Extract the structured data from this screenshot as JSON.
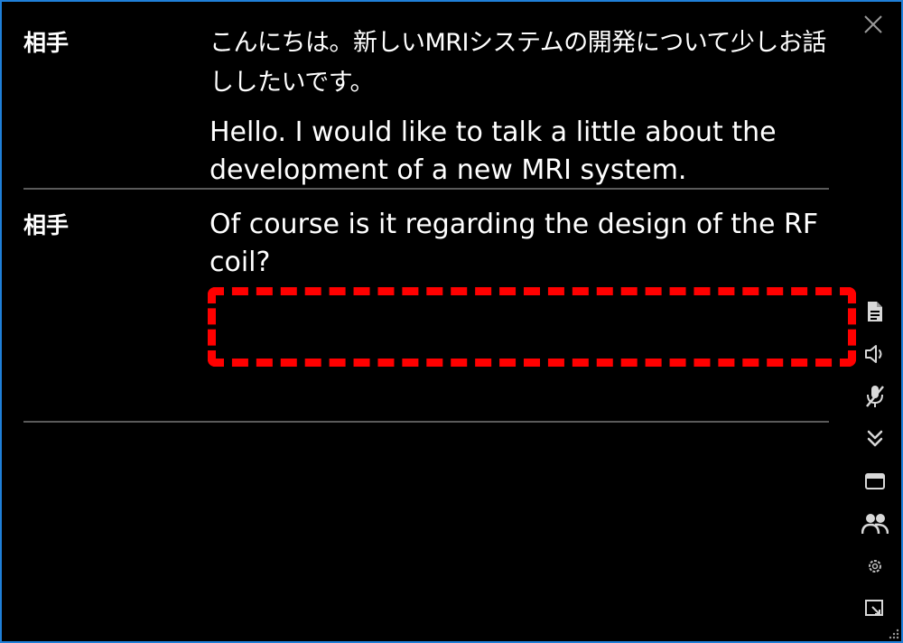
{
  "entries": [
    {
      "speaker": "相手",
      "original": "こんにちは。新しいMRIシステムの開発について少しお話ししたいです。",
      "translation": "Hello. I would like to talk a little about the development of a new MRI system."
    },
    {
      "speaker": "相手",
      "original": "",
      "translation": "Of course is it regarding the design of the RF coil?"
    }
  ],
  "toolbar": {
    "icons": [
      "document-icon",
      "speaker-icon",
      "mic-muted-icon",
      "scroll-down-icon",
      "window-icon",
      "participants-icon",
      "gear-icon",
      "picture-in-picture-icon"
    ]
  },
  "colors": {
    "background": "#000000",
    "text": "#ffffff",
    "divider": "#5a5a5a",
    "highlight": "#ff0000",
    "window_border": "#1f7fd8",
    "icon": "#d8d8d8"
  }
}
